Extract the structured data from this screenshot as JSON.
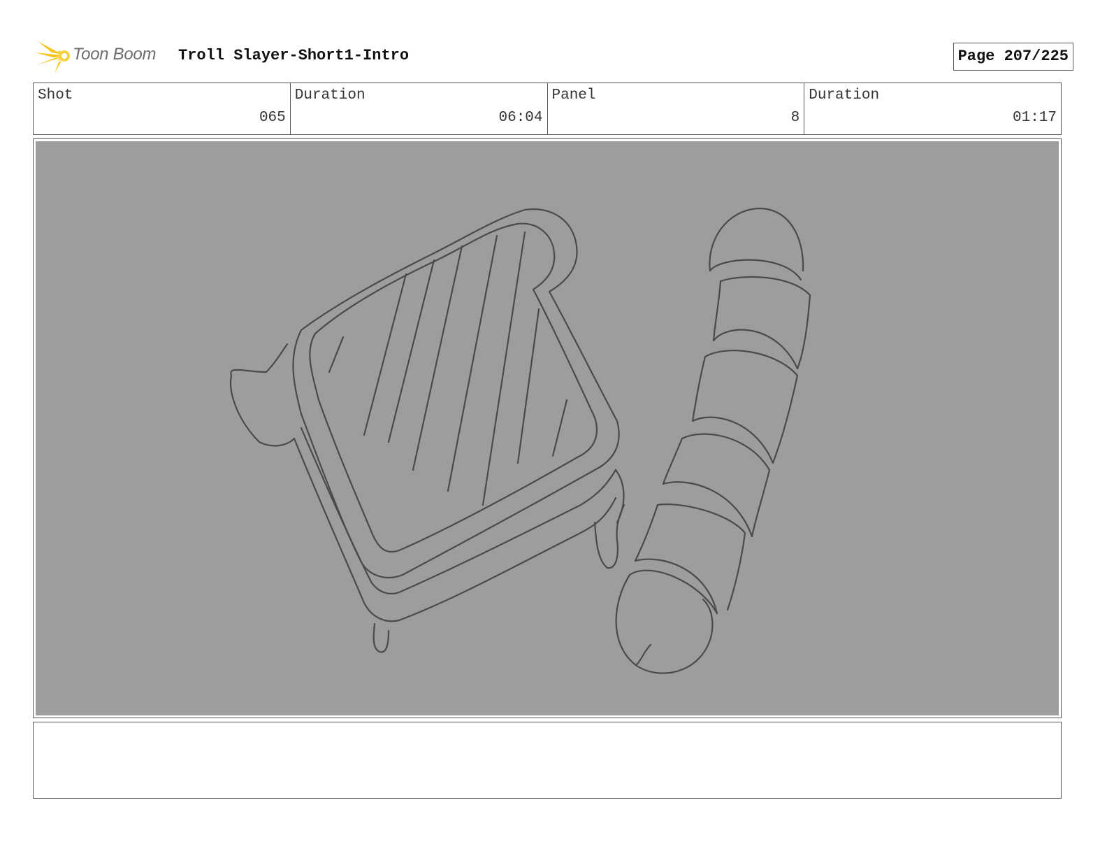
{
  "header": {
    "logo_text": "Toon Boom",
    "title": "Troll Slayer-Short1-Intro",
    "page": "Page 207/225"
  },
  "info": {
    "shot_label": "Shot",
    "shot_value": "065",
    "shot_duration_label": "Duration",
    "shot_duration_value": "06:04",
    "panel_label": "Panel",
    "panel_value": "8",
    "panel_duration_label": "Duration",
    "panel_duration_value": "01:17"
  },
  "notes": {
    "text": ""
  },
  "colors": {
    "canvas_bg": "#9d9d9d",
    "logo_yellow": "#f5c518",
    "sketch_line": "#4a4a4a"
  }
}
